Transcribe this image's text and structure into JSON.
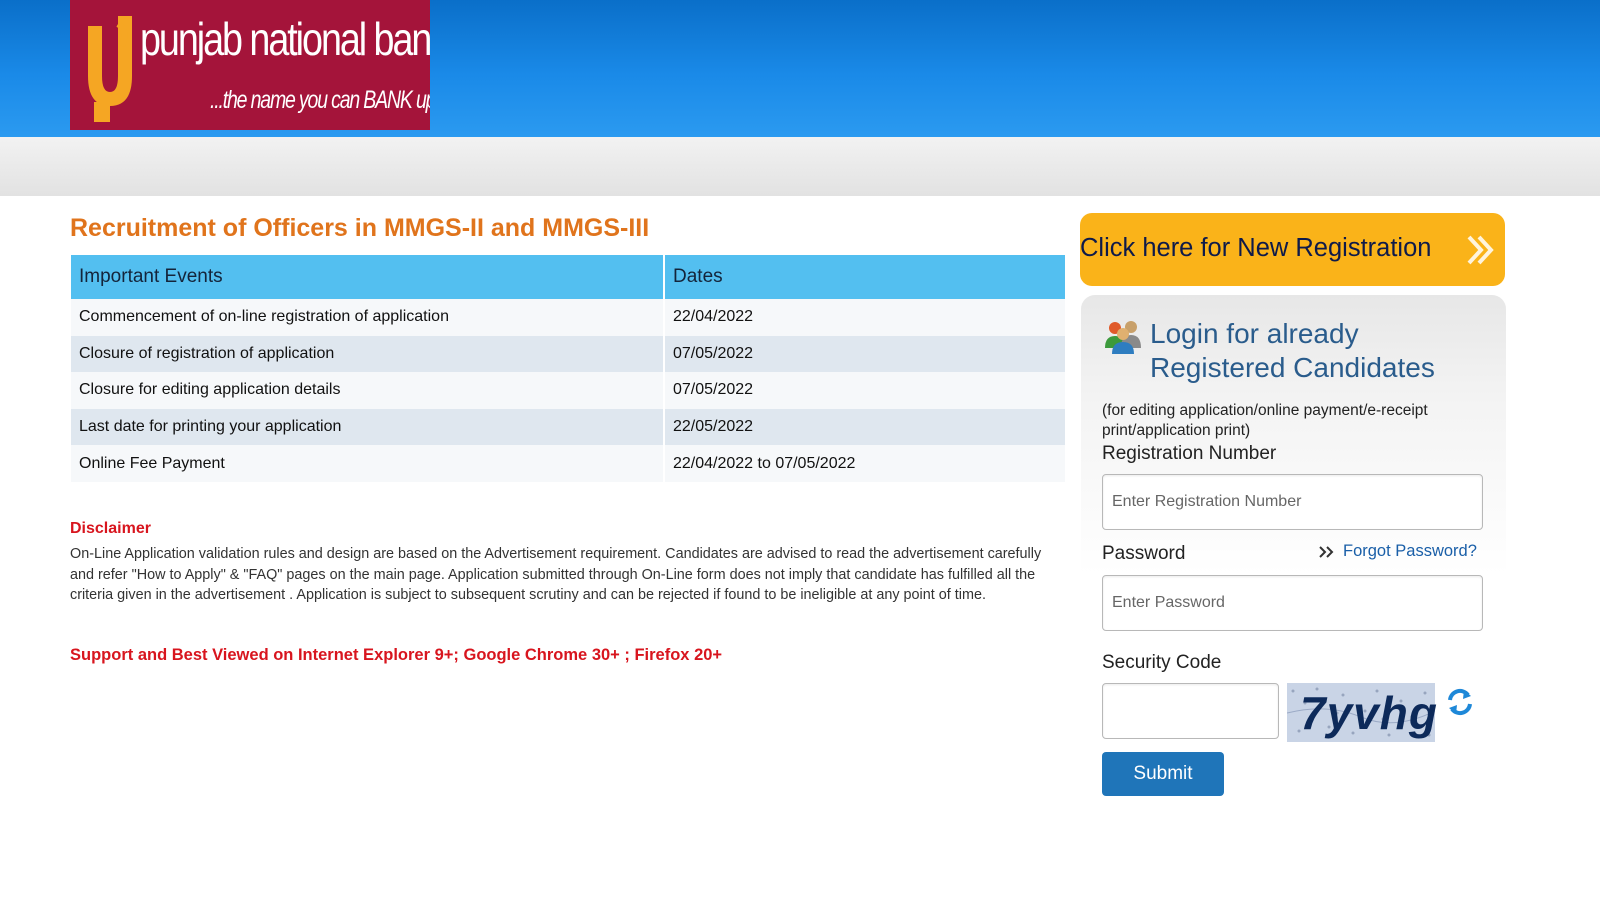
{
  "brand": {
    "name": "punjab national bank",
    "tagline": "...the name you can BANK upon !",
    "logo_color": "#a4143a",
    "mark_color": "#f5a623"
  },
  "page": {
    "title": "Recruitment of Officers in MMGS-II and MMGS-III"
  },
  "events_table": {
    "headers": [
      "Important Events",
      "Dates"
    ],
    "rows": [
      [
        "Commencement of on-line registration of application",
        "22/04/2022"
      ],
      [
        "Closure of registration of application",
        "07/05/2022"
      ],
      [
        "Closure for editing application details",
        "07/05/2022"
      ],
      [
        "Last date for printing your application",
        "22/05/2022"
      ],
      [
        "Online Fee Payment",
        "22/04/2022 to 07/05/2022"
      ]
    ]
  },
  "disclaimer": {
    "title": "Disclaimer",
    "text": "On-Line Application validation rules and design are based on the Advertisement requirement. Candidates are advised to read the advertisement carefully and refer \"How to Apply\" & \"FAQ\" pages on the main page. Application submitted through On-Line form does not imply that candidate has fulfilled all the criteria given in the advertisement . Application is subject to subsequent scrutiny and can be rejected if found to be ineligible at any point of time.",
    "browser_note": "Support and Best Viewed on Internet Explorer 9+; Google Chrome 30+ ; Firefox 20+"
  },
  "new_registration": {
    "label": "Click here for New Registration",
    "icon": "double-chevron-right-icon"
  },
  "login": {
    "icon": "users-icon",
    "title": "Login for already Registered Candidates",
    "note": "(for editing application/online payment/e-receipt print/application print)",
    "registration_label": "Registration Number",
    "registration_placeholder": "Enter Registration Number",
    "password_label": "Password",
    "password_placeholder": "Enter Password",
    "forgot_label": "Forgot Password?",
    "security_label": "Security Code",
    "security_value": "",
    "captcha_text": "7yvhg",
    "refresh_icon": "refresh-icon",
    "submit_label": "Submit"
  }
}
